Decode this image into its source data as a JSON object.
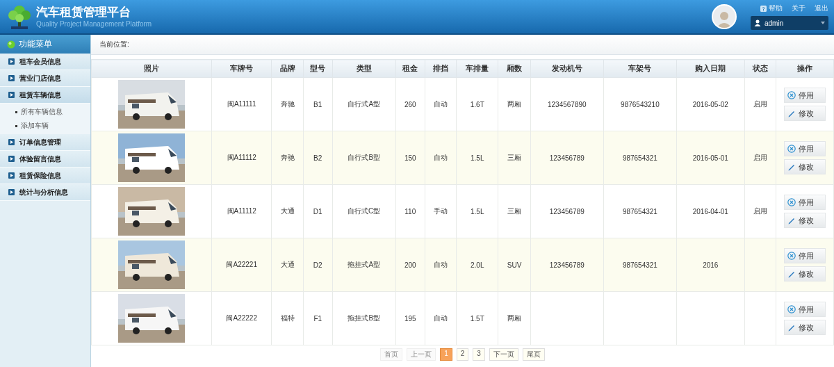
{
  "header": {
    "title": "汽车租赁管理平台",
    "subtitle": "Quality Project Management Platform",
    "links": [
      "帮助",
      "关于",
      "退出"
    ],
    "user": "admin"
  },
  "sidebar": {
    "title": "功能菜单",
    "items": [
      {
        "label": "租车会员信息"
      },
      {
        "label": "营业门店信息"
      },
      {
        "label": "租赁车辆信息",
        "expanded": true,
        "children": [
          {
            "label": "所有车辆信息"
          },
          {
            "label": "添加车辆"
          }
        ]
      },
      {
        "label": "订单信息管理"
      },
      {
        "label": "体验留言信息"
      },
      {
        "label": "租赁保险信息"
      },
      {
        "label": "统计与分析信息"
      }
    ]
  },
  "breadcrumb": "当前位置:",
  "table": {
    "columns": [
      "照片",
      "车牌号",
      "品牌",
      "型号",
      "类型",
      "租金",
      "排挡",
      "车排量",
      "厢数",
      "发动机号",
      "车架号",
      "购入日期",
      "状态",
      "操作"
    ],
    "rows": [
      {
        "cells": [
          {
            "kind": "picture"
          },
          "闽A11111",
          "奔驰",
          "B1",
          "自行式A型",
          "260",
          "自动",
          "1.6T",
          "两厢",
          "1234567890",
          "9876543210",
          "2016-05-02",
          "启用",
          {
            "kind": "actions",
            "buttons": [
              "停用",
              "修改"
            ]
          }
        ]
      },
      {
        "cells": [
          {
            "kind": "picture"
          },
          "闽A11112",
          "奔驰",
          "B2",
          "自行式B型",
          "150",
          "自动",
          "1.5L",
          "三厢",
          "123456789",
          "987654321",
          "2016-05-01",
          "启用",
          {
            "kind": "actions",
            "buttons": [
              "停用",
              "修改"
            ]
          }
        ]
      },
      {
        "cells": [
          {
            "kind": "picture"
          },
          "闽A11112",
          "大通",
          "D1",
          "自行式C型",
          "110",
          "手动",
          "1.5L",
          "三厢",
          "123456789",
          "987654321",
          "2016-04-01",
          "启用",
          {
            "kind": "actions",
            "buttons": [
              "停用",
              "修改"
            ]
          }
        ]
      },
      {
        "cells": [
          {
            "kind": "picture"
          },
          "闽A22221",
          "大通",
          "D2",
          "拖挂式A型",
          "200",
          "自动",
          "2.0L",
          "SUV",
          "123456789",
          "987654321",
          "2016",
          null,
          {
            "kind": "actions",
            "buttons": [
              "停用",
              "修改"
            ]
          }
        ]
      },
      {
        "cells": [
          {
            "kind": "picture"
          },
          "闽A22222",
          "福特",
          "F1",
          "拖挂式B型",
          "195",
          "自动",
          "1.5T",
          "两厢",
          null,
          null,
          null,
          null,
          {
            "kind": "actions",
            "buttons": [
              "停用",
              "修改"
            ]
          }
        ]
      }
    ]
  },
  "pagination": [
    {
      "label": "首页",
      "disabled": true,
      "selected": false
    },
    {
      "label": "上一页",
      "disabled": true,
      "selected": false
    },
    {
      "label": "1",
      "disabled": false,
      "selected": true
    },
    {
      "label": "2",
      "disabled": false,
      "selected": false
    },
    {
      "label": "3",
      "disabled": false,
      "selected": false
    },
    {
      "label": "下一页",
      "disabled": false,
      "selected": false
    },
    {
      "label": "尾页",
      "disabled": false,
      "selected": false
    }
  ]
}
